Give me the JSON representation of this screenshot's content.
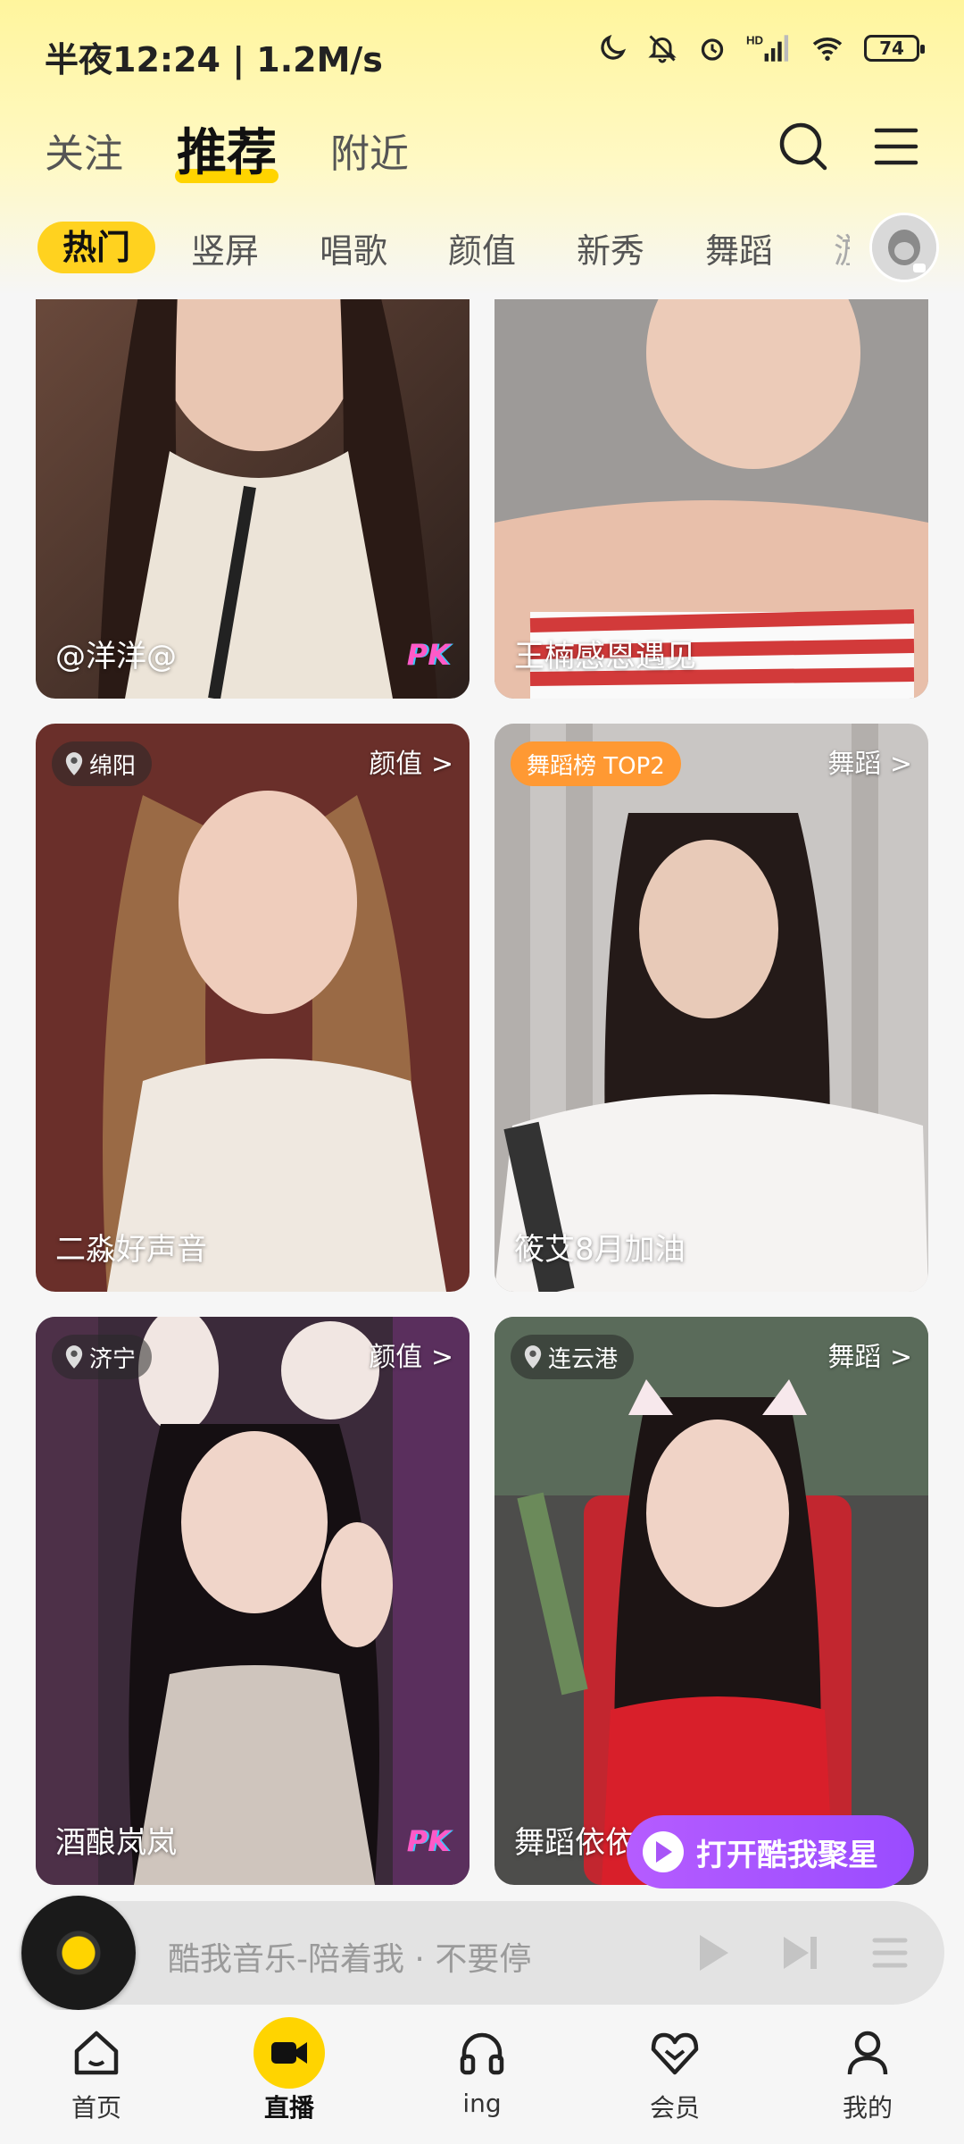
{
  "status_bar": {
    "time": "半夜12:24 | 1.2M/s",
    "battery": "74"
  },
  "header": {
    "tabs": [
      {
        "label": "关注"
      },
      {
        "label": "推荐"
      },
      {
        "label": "附近"
      }
    ],
    "active_tab": "推荐"
  },
  "categories": {
    "items": [
      "热门",
      "竖屏",
      "唱歌",
      "颜值",
      "新秀",
      "舞蹈",
      "游"
    ],
    "active": "热门"
  },
  "cards": [
    {
      "name": "@洋洋@",
      "pk": "PK"
    },
    {
      "name": "王楠感恩遇见"
    },
    {
      "name": "二淼好声音",
      "location": "绵阳",
      "category": "颜值 >"
    },
    {
      "name": "筱艾8月加油",
      "rank": "舞蹈榜 TOP2",
      "category": "舞蹈 >"
    },
    {
      "name": "酒酿岚岚",
      "location": "济宁",
      "category": "颜值 >",
      "pk": "PK"
    },
    {
      "name": "舞蹈依依",
      "location": "连云港",
      "category": "舞蹈 >"
    }
  ],
  "open_app": {
    "label": "打开酷我聚星"
  },
  "music_bar": {
    "title": "酷我音乐-陪着我 · 不要停"
  },
  "bottom_nav": {
    "items": [
      {
        "label": "首页",
        "icon": "home-icon"
      },
      {
        "label": "直播",
        "icon": "live-camera-icon"
      },
      {
        "label": "ing",
        "icon": "headphones-icon"
      },
      {
        "label": "会员",
        "icon": "vip-heart-icon"
      },
      {
        "label": "我的",
        "icon": "profile-icon"
      }
    ],
    "active": "直播"
  },
  "colors": {
    "accent": "#ffd400",
    "open_app": "#a855f7",
    "rank_badge": "#ff9933"
  }
}
